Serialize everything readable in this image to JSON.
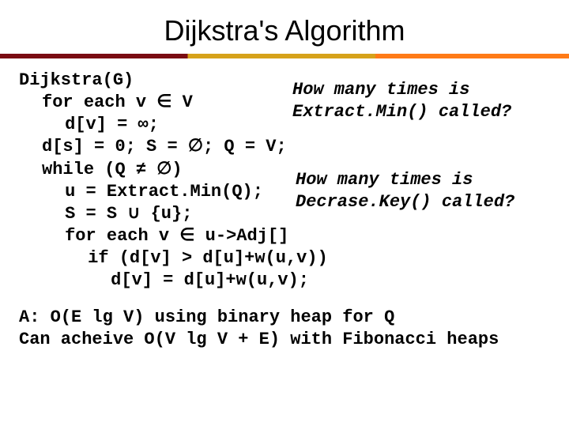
{
  "title": "Dijkstra's Algorithm",
  "code": {
    "l0": "Dijkstra(G)",
    "l1": "for each v ∈ V",
    "l2": "d[v] = ∞;",
    "l3": "d[s] = 0; S = ∅; Q = V;",
    "l4": "while (Q ≠ ∅)",
    "l5": "u = Extract.Min(Q);",
    "l6": "S = S ∪ {u};",
    "l7": "for each v ∈ u->Adj[]",
    "l8": "if (d[v] > d[u]+w(u,v))",
    "l9": "d[v] = d[u]+w(u,v);"
  },
  "annot": {
    "a1l1": "How many times is",
    "a1l2": "Extract.Min() called?",
    "a2l1": "How many times is",
    "a2l2": "Decrase.Key() called?"
  },
  "answer": {
    "l1": "A: O(E lg V) using binary heap for Q",
    "l2": "Can acheive O(V lg V + E) with Fibonacci heaps"
  }
}
